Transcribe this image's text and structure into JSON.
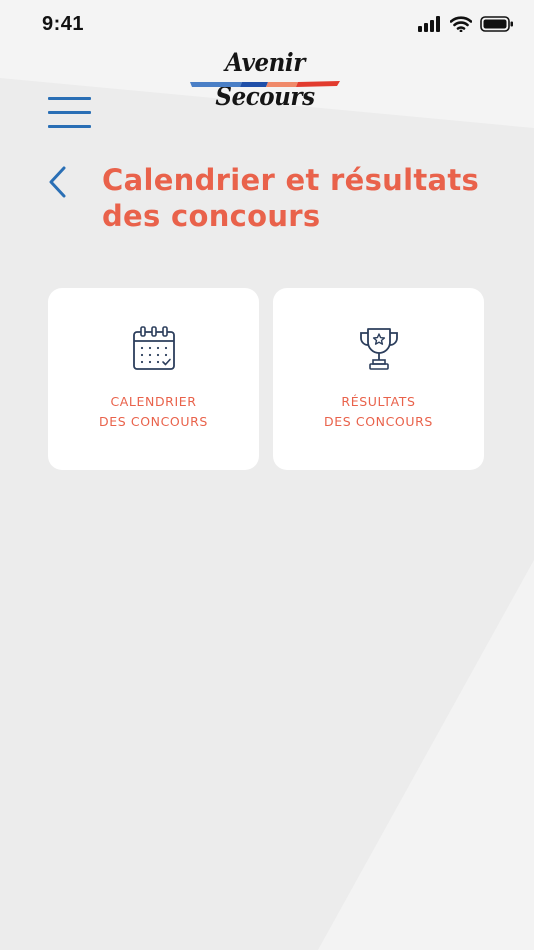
{
  "status_bar": {
    "time": "9:41",
    "icons": [
      "signal-icon",
      "wifi-icon",
      "battery-icon"
    ]
  },
  "header": {
    "logo_text": "Avenir Secours",
    "menu_icon": "hamburger-menu-icon"
  },
  "page": {
    "back_icon": "chevron-left-icon",
    "title_line1": "Calendrier et résultats",
    "title_line2": "des concours"
  },
  "cards": [
    {
      "icon": "calendar-icon",
      "label_line1": "CALENDRIER",
      "label_line2": "DES CONCOURS"
    },
    {
      "icon": "trophy-icon",
      "label_line1": "RÉSULTATS",
      "label_line2": "DES CONCOURS"
    }
  ],
  "colors": {
    "accent_orange": "#e9624b",
    "accent_blue": "#2a6fb5",
    "background": "#ececec",
    "card": "#ffffff"
  }
}
